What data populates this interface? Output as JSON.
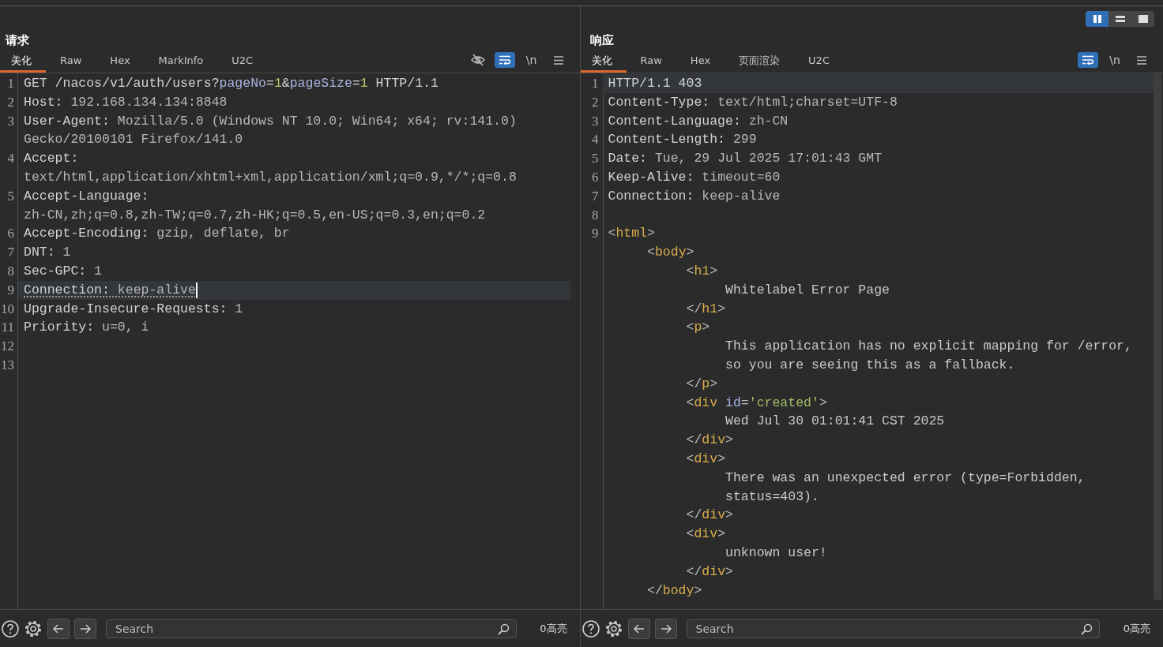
{
  "view_modes": [
    {
      "kind": "columns",
      "selected": true
    },
    {
      "kind": "rows",
      "selected": false
    },
    {
      "kind": "single",
      "selected": false
    }
  ],
  "panels": [
    {
      "title": "请求",
      "tabs": [
        {
          "label": "美化",
          "selected": true
        },
        {
          "label": "Raw",
          "selected": false
        },
        {
          "label": "Hex",
          "selected": false
        },
        {
          "label": "MarkInfo",
          "selected": false
        },
        {
          "label": "U2C",
          "selected": false
        }
      ],
      "tools": [
        {
          "kind": "hide",
          "on": false
        },
        {
          "kind": "wrap",
          "on": true
        },
        {
          "kind": "newline",
          "label": "\\n",
          "on": false
        },
        {
          "kind": "menu",
          "on": false
        }
      ],
      "lines": [
        {
          "number": "1",
          "rows": [
            {
              "tokens": [
                {
                  "kind": "plain",
                  "text": "GET /nacos/v1/auth/users?"
                },
                {
                  "kind": "param",
                  "text": "pageNo"
                },
                {
                  "kind": "plain",
                  "text": "="
                },
                {
                  "kind": "num",
                  "text": "1"
                },
                {
                  "kind": "plain",
                  "text": "&"
                },
                {
                  "kind": "param",
                  "text": "pageSize"
                },
                {
                  "kind": "plain",
                  "text": "="
                },
                {
                  "kind": "num",
                  "text": "1"
                },
                {
                  "kind": "plain",
                  "text": " HTTP/1.1"
                }
              ]
            }
          ]
        },
        {
          "number": "2",
          "rows": [
            {
              "tokens": [
                {
                  "kind": "name",
                  "text": "Host:"
                },
                {
                  "kind": "value",
                  "text": " 192.168.134.134:8848"
                }
              ]
            }
          ]
        },
        {
          "number": "3",
          "rows": [
            {
              "tokens": [
                {
                  "kind": "name",
                  "text": "User-Agent:"
                },
                {
                  "kind": "value",
                  "text": " Mozilla/5.0 (Windows NT 10.0; Win64; x64; rv:141.0)"
                }
              ]
            },
            {
              "tokens": [
                {
                  "kind": "value",
                  "text": "Gecko/20100101 Firefox/141.0"
                }
              ]
            }
          ]
        },
        {
          "number": "4",
          "rows": [
            {
              "tokens": [
                {
                  "kind": "name",
                  "text": "Accept:"
                }
              ]
            },
            {
              "tokens": [
                {
                  "kind": "value",
                  "text": "text/html,application/xhtml+xml,application/xml;q=0.9,*/*;q=0.8"
                }
              ]
            }
          ]
        },
        {
          "number": "5",
          "rows": [
            {
              "tokens": [
                {
                  "kind": "name",
                  "text": "Accept-Language:"
                }
              ]
            },
            {
              "tokens": [
                {
                  "kind": "value",
                  "text": "zh-CN,zh;q=0.8,zh-TW;q=0.7,zh-HK;q=0.5,en-US;q=0.3,en;q=0.2"
                }
              ]
            }
          ]
        },
        {
          "number": "6",
          "rows": [
            {
              "tokens": [
                {
                  "kind": "name",
                  "text": "Accept-Encoding:"
                },
                {
                  "kind": "value",
                  "text": " gzip, deflate, br"
                }
              ]
            }
          ]
        },
        {
          "number": "7",
          "rows": [
            {
              "tokens": [
                {
                  "kind": "name",
                  "text": "DNT:"
                },
                {
                  "kind": "value",
                  "text": " 1"
                }
              ]
            }
          ]
        },
        {
          "number": "8",
          "rows": [
            {
              "tokens": [
                {
                  "kind": "name",
                  "text": "Sec-GPC:"
                },
                {
                  "kind": "value",
                  "text": " 1"
                }
              ]
            }
          ]
        },
        {
          "number": "9",
          "highlighted": true,
          "cursor": true,
          "underlined": true,
          "rows": [
            {
              "tokens": [
                {
                  "kind": "name",
                  "text": "Connection:"
                },
                {
                  "kind": "value",
                  "text": " keep-alive"
                }
              ]
            }
          ]
        },
        {
          "number": "10",
          "rows": [
            {
              "tokens": [
                {
                  "kind": "name",
                  "text": "Upgrade-Insecure-Requests:"
                },
                {
                  "kind": "value",
                  "text": " 1"
                }
              ]
            }
          ]
        },
        {
          "number": "11",
          "rows": [
            {
              "tokens": [
                {
                  "kind": "name",
                  "text": "Priority:"
                },
                {
                  "kind": "value",
                  "text": " u=0, i"
                }
              ]
            }
          ]
        },
        {
          "number": "12"
        },
        {
          "number": "13"
        }
      ],
      "footer": {
        "search_placeholder": "Search",
        "highlight_count": "0高亮"
      }
    },
    {
      "title": "响应",
      "tabs": [
        {
          "label": "美化",
          "selected": true
        },
        {
          "label": "Raw",
          "selected": false
        },
        {
          "label": "Hex",
          "selected": false
        },
        {
          "label": "页面渲染",
          "selected": false
        },
        {
          "label": "U2C",
          "selected": false
        }
      ],
      "tools": [
        {
          "kind": "wrap",
          "on": true
        },
        {
          "kind": "newline",
          "label": "\\n",
          "on": false
        },
        {
          "kind": "menu",
          "on": false
        }
      ],
      "lines": [
        {
          "number": "1",
          "highlighted": true,
          "rows": [
            {
              "tokens": [
                {
                  "kind": "plain",
                  "text": "HTTP/1.1 403"
                }
              ]
            }
          ]
        },
        {
          "number": "2",
          "rows": [
            {
              "tokens": [
                {
                  "kind": "name",
                  "text": "Content-Type:"
                },
                {
                  "kind": "value",
                  "text": " text/html;charset=UTF-8"
                }
              ]
            }
          ]
        },
        {
          "number": "3",
          "rows": [
            {
              "tokens": [
                {
                  "kind": "name",
                  "text": "Content-Language:"
                },
                {
                  "kind": "value",
                  "text": " zh-CN"
                }
              ]
            }
          ]
        },
        {
          "number": "4",
          "rows": [
            {
              "tokens": [
                {
                  "kind": "name",
                  "text": "Content-Length:"
                },
                {
                  "kind": "value",
                  "text": " 299"
                }
              ]
            }
          ]
        },
        {
          "number": "5",
          "rows": [
            {
              "tokens": [
                {
                  "kind": "name",
                  "text": "Date:"
                },
                {
                  "kind": "value",
                  "text": " Tue, 29 Jul 2025 17:01:43 GMT"
                }
              ]
            }
          ]
        },
        {
          "number": "6",
          "rows": [
            {
              "tokens": [
                {
                  "kind": "name",
                  "text": "Keep-Alive:"
                },
                {
                  "kind": "value",
                  "text": " timeout=60"
                }
              ]
            }
          ]
        },
        {
          "number": "7",
          "rows": [
            {
              "tokens": [
                {
                  "kind": "name",
                  "text": "Connection:"
                },
                {
                  "kind": "value",
                  "text": " keep-alive"
                }
              ]
            }
          ]
        },
        {
          "number": "8"
        },
        {
          "number": "9",
          "rows": [
            {
              "tokens": [
                {
                  "kind": "punct",
                  "text": "<"
                },
                {
                  "kind": "tag",
                  "text": "html"
                },
                {
                  "kind": "punct",
                  "text": ">"
                }
              ]
            },
            {
              "tokens": [
                {
                  "kind": "punct",
                  "text": "     <"
                },
                {
                  "kind": "tag",
                  "text": "body"
                },
                {
                  "kind": "punct",
                  "text": ">"
                }
              ]
            },
            {
              "tokens": [
                {
                  "kind": "punct",
                  "text": "          <"
                },
                {
                  "kind": "tag",
                  "text": "h1"
                },
                {
                  "kind": "punct",
                  "text": ">"
                }
              ]
            },
            {
              "tokens": [
                {
                  "kind": "text",
                  "text": "               Whitelabel Error Page"
                }
              ]
            },
            {
              "tokens": [
                {
                  "kind": "punct",
                  "text": "          </"
                },
                {
                  "kind": "tag",
                  "text": "h1"
                },
                {
                  "kind": "punct",
                  "text": ">"
                }
              ]
            },
            {
              "tokens": [
                {
                  "kind": "punct",
                  "text": "          <"
                },
                {
                  "kind": "tag",
                  "text": "p"
                },
                {
                  "kind": "punct",
                  "text": ">"
                }
              ]
            },
            {
              "tokens": [
                {
                  "kind": "text",
                  "text": "               This application has no explicit mapping for /error,"
                }
              ]
            },
            {
              "tokens": [
                {
                  "kind": "text",
                  "text": "               so you are seeing this as a fallback."
                }
              ]
            },
            {
              "tokens": [
                {
                  "kind": "punct",
                  "text": "          </"
                },
                {
                  "kind": "tag",
                  "text": "p"
                },
                {
                  "kind": "punct",
                  "text": ">"
                }
              ]
            },
            {
              "tokens": [
                {
                  "kind": "punct",
                  "text": "          <"
                },
                {
                  "kind": "tag",
                  "text": "div"
                },
                {
                  "kind": "attr",
                  "text": " id"
                },
                {
                  "kind": "punct",
                  "text": "="
                },
                {
                  "kind": "string",
                  "text": "'created'"
                },
                {
                  "kind": "punct",
                  "text": ">"
                }
              ]
            },
            {
              "tokens": [
                {
                  "kind": "text",
                  "text": "               Wed Jul 30 01:01:41 CST 2025"
                }
              ]
            },
            {
              "tokens": [
                {
                  "kind": "punct",
                  "text": "          </"
                },
                {
                  "kind": "tag",
                  "text": "div"
                },
                {
                  "kind": "punct",
                  "text": ">"
                }
              ]
            },
            {
              "tokens": [
                {
                  "kind": "punct",
                  "text": "          <"
                },
                {
                  "kind": "tag",
                  "text": "div"
                },
                {
                  "kind": "punct",
                  "text": ">"
                }
              ]
            },
            {
              "tokens": [
                {
                  "kind": "text",
                  "text": "               There was an unexpected error (type=Forbidden,"
                }
              ]
            },
            {
              "tokens": [
                {
                  "kind": "text",
                  "text": "               status=403)."
                }
              ]
            },
            {
              "tokens": [
                {
                  "kind": "punct",
                  "text": "          </"
                },
                {
                  "kind": "tag",
                  "text": "div"
                },
                {
                  "kind": "punct",
                  "text": ">"
                }
              ]
            },
            {
              "tokens": [
                {
                  "kind": "punct",
                  "text": "          <"
                },
                {
                  "kind": "tag",
                  "text": "div"
                },
                {
                  "kind": "punct",
                  "text": ">"
                }
              ]
            },
            {
              "tokens": [
                {
                  "kind": "text",
                  "text": "               unknown user!"
                }
              ]
            },
            {
              "tokens": [
                {
                  "kind": "punct",
                  "text": "          </"
                },
                {
                  "kind": "tag",
                  "text": "div"
                },
                {
                  "kind": "punct",
                  "text": ">"
                }
              ]
            },
            {
              "tokens": [
                {
                  "kind": "punct",
                  "text": "     </"
                },
                {
                  "kind": "tag",
                  "text": "body"
                },
                {
                  "kind": "punct",
                  "text": ">"
                }
              ]
            }
          ]
        }
      ],
      "footer": {
        "search_placeholder": "Search",
        "highlight_count": "0高亮"
      }
    }
  ]
}
